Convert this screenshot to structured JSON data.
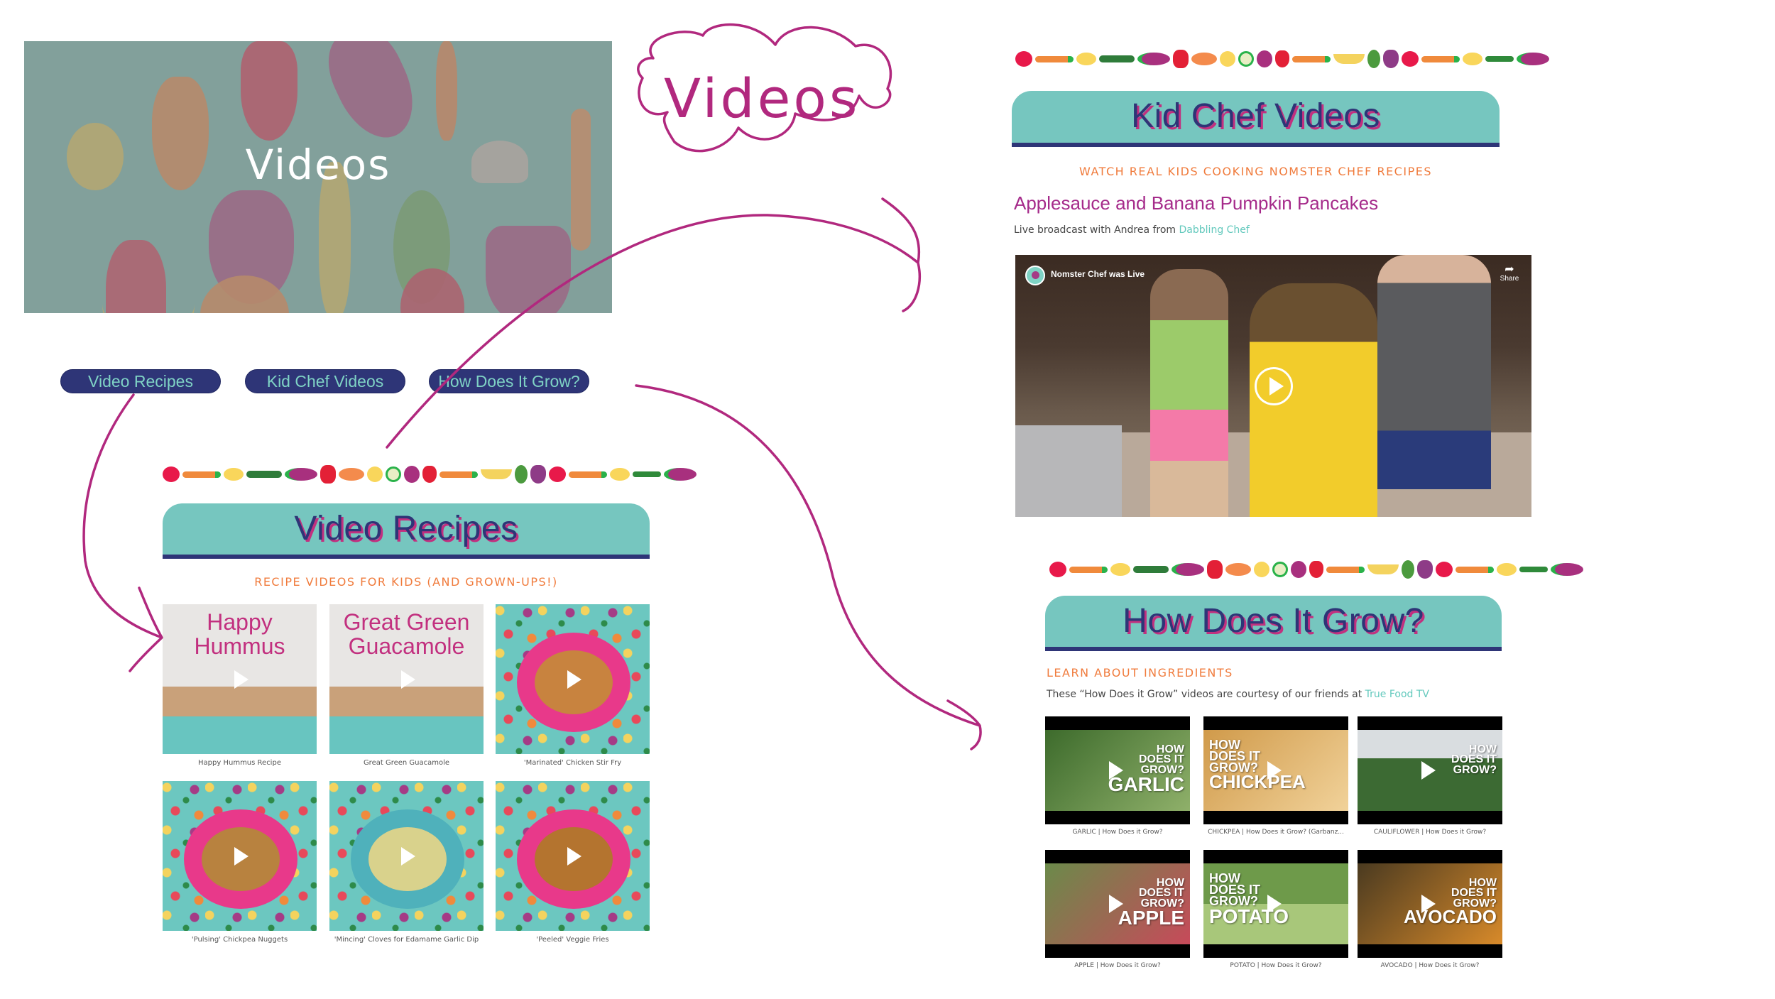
{
  "hero": {
    "title": "Videos"
  },
  "annotation": {
    "cloud_label": "Videos",
    "ink_color": "#b1287e"
  },
  "nav": {
    "buttons": [
      {
        "label": "Video Recipes"
      },
      {
        "label": "Kid Chef Videos"
      },
      {
        "label": "How Does It Grow?"
      }
    ]
  },
  "colors": {
    "teal": "#76c6bf",
    "navy": "#2e3577",
    "orange": "#f07b3c",
    "magenta": "#b1287e",
    "link": "#63c9bd"
  },
  "veg_strip": [
    "tomato",
    "carrot",
    "lemon",
    "cucumber",
    "eggplant",
    "pepper",
    "squash",
    "apple",
    "kiwi",
    "beet",
    "strawberry",
    "carrot",
    "banana",
    "avocado",
    "grapes",
    "tomato",
    "carrot",
    "lemon",
    "herb",
    "eggplant"
  ],
  "video_recipes": {
    "title": "Video Recipes",
    "subtitle": "RECIPE VIDEOS FOR KIDS (AND GROWN-UPS!)",
    "items": [
      {
        "caption": "Happy Hummus Recipe",
        "overlay": "Happy Hummus"
      },
      {
        "caption": "Great Green Guacamole",
        "overlay": "Great Green Guacamole"
      },
      {
        "caption": "'Marinated' Chicken Stir Fry",
        "overlay": ""
      },
      {
        "caption": "'Pulsing' Chickpea Nuggets",
        "overlay": ""
      },
      {
        "caption": "'Mincing' Cloves for Edamame Garlic Dip",
        "overlay": ""
      },
      {
        "caption": "'Peeled' Veggie Fries",
        "overlay": ""
      }
    ]
  },
  "kid_chef": {
    "title": "Kid Chef Videos",
    "subtitle": "WATCH REAL KIDS COOKING NOMSTER CHEF RECIPES",
    "recipe_title": "Applesauce and Banana Pumpkin Pancakes",
    "description_prefix": "Live broadcast with Andrea from",
    "description_link": "Dabbling Chef",
    "video": {
      "channel": "Nomster Chef was Live",
      "share_label": "Share"
    }
  },
  "how_grow": {
    "title": "How Does It Grow?",
    "subtitle": "LEARN ABOUT INGREDIENTS",
    "description_prefix": "These “How Does it Grow” videos are courtesy of our friends at",
    "description_link": "True Food TV",
    "overlay_phrase": "HOW DOES IT GROW?",
    "items": [
      {
        "caption": "GARLIC | How Does it Grow?",
        "word": "GARLIC"
      },
      {
        "caption": "CHICKPEA | How Does it Grow? (Garbanz...",
        "word": "CHICKPEA"
      },
      {
        "caption": "CAULIFLOWER | How Does it Grow?",
        "word": ""
      },
      {
        "caption": "APPLE | How Does it Grow?",
        "word": "APPLE"
      },
      {
        "caption": "POTATO | How Does it Grow?",
        "word": "POTATO"
      },
      {
        "caption": "AVOCADO | How Does it Grow?",
        "word": "AVOCADO"
      }
    ]
  }
}
